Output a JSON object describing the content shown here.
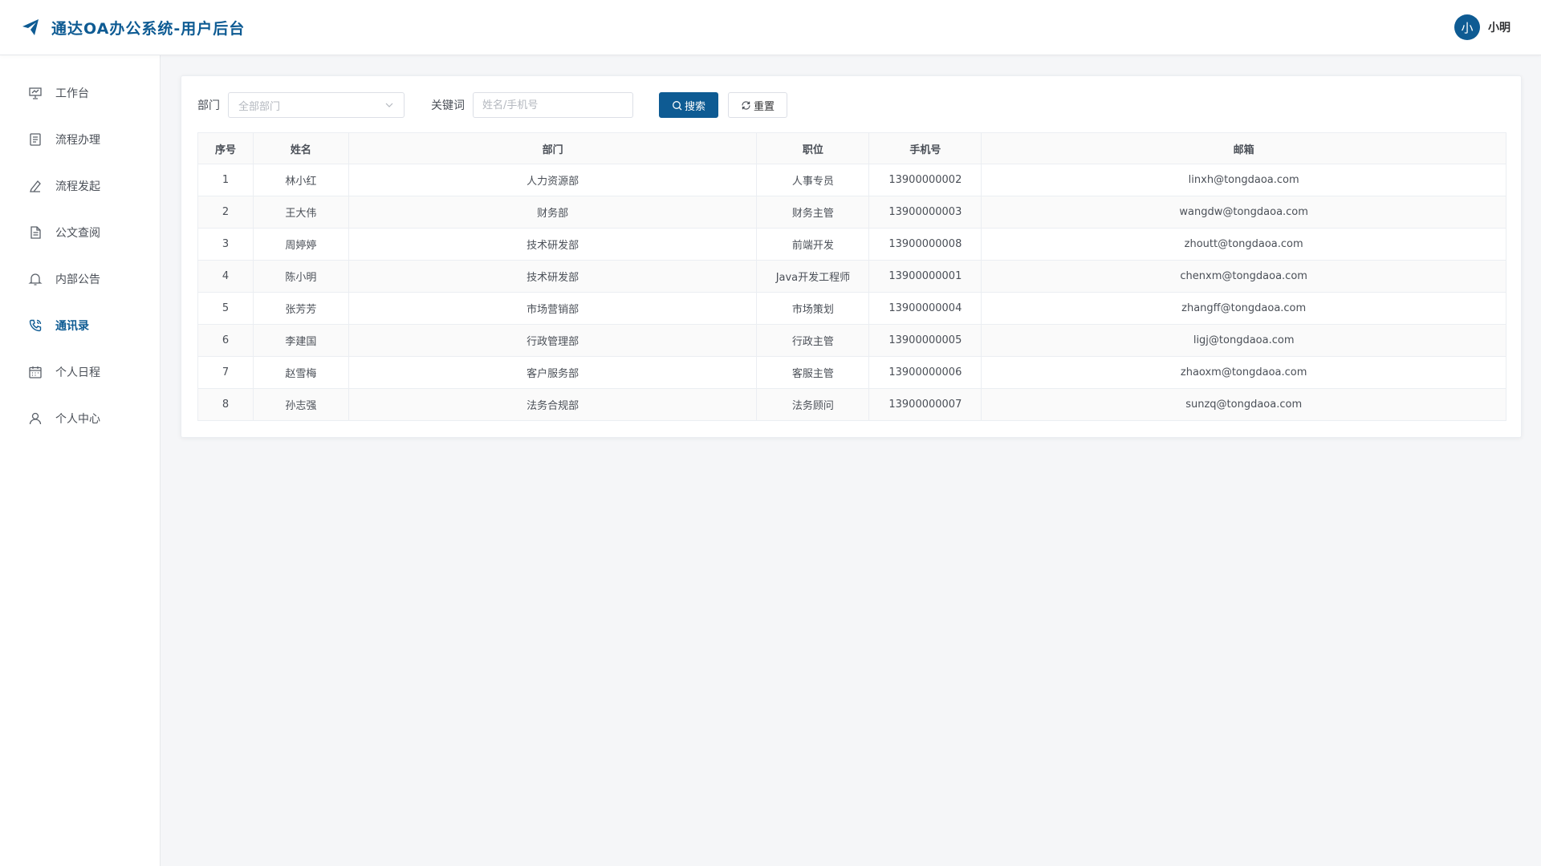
{
  "header": {
    "title": "通达OA办公系统-用户后台",
    "avatar_char": "小",
    "username": "小明"
  },
  "sidebar": {
    "items": [
      {
        "label": "工作台",
        "icon": "presentation-icon",
        "active": false
      },
      {
        "label": "流程办理",
        "icon": "document-list-icon",
        "active": false
      },
      {
        "label": "流程发起",
        "icon": "pen-icon",
        "active": false
      },
      {
        "label": "公文查阅",
        "icon": "file-icon",
        "active": false
      },
      {
        "label": "内部公告",
        "icon": "bell-icon",
        "active": false
      },
      {
        "label": "通讯录",
        "icon": "phone-icon",
        "active": true
      },
      {
        "label": "个人日程",
        "icon": "calendar-icon",
        "active": false
      },
      {
        "label": "个人中心",
        "icon": "user-icon",
        "active": false
      }
    ]
  },
  "toolbar": {
    "dept_label": "部门",
    "dept_placeholder": "全部部门",
    "keyword_label": "关键词",
    "keyword_placeholder": "姓名/手机号",
    "search_label": "搜索",
    "reset_label": "重置"
  },
  "table": {
    "headers": [
      "序号",
      "姓名",
      "部门",
      "职位",
      "手机号",
      "邮箱"
    ],
    "rows": [
      [
        "1",
        "林小红",
        "人力资源部",
        "人事专员",
        "13900000002",
        "linxh@tongdaoa.com"
      ],
      [
        "2",
        "王大伟",
        "财务部",
        "财务主管",
        "13900000003",
        "wangdw@tongdaoa.com"
      ],
      [
        "3",
        "周婷婷",
        "技术研发部",
        "前端开发",
        "13900000008",
        "zhoutt@tongdaoa.com"
      ],
      [
        "4",
        "陈小明",
        "技术研发部",
        "Java开发工程师",
        "13900000001",
        "chenxm@tongdaoa.com"
      ],
      [
        "5",
        "张芳芳",
        "市场营销部",
        "市场策划",
        "13900000004",
        "zhangff@tongdaoa.com"
      ],
      [
        "6",
        "李建国",
        "行政管理部",
        "行政主管",
        "13900000005",
        "ligj@tongdaoa.com"
      ],
      [
        "7",
        "赵雪梅",
        "客户服务部",
        "客服主管",
        "13900000006",
        "zhaoxm@tongdaoa.com"
      ],
      [
        "8",
        "孙志强",
        "法务合规部",
        "法务顾问",
        "13900000007",
        "sunzq@tongdaoa.com"
      ]
    ]
  },
  "colors": {
    "accent": "#0e5b93"
  }
}
